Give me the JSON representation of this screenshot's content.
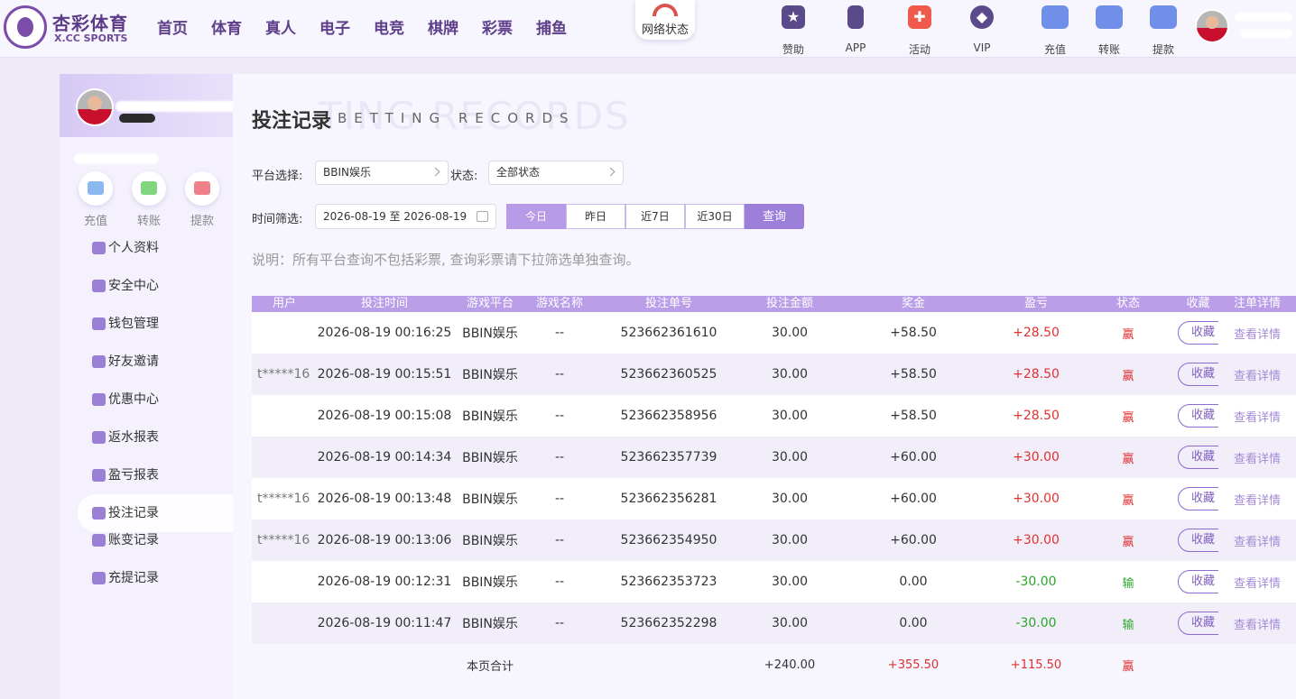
{
  "header": {
    "brand_title": "杏彩体育",
    "brand_sub": "X.CC SPORTS",
    "nav": [
      "首页",
      "体育",
      "真人",
      "电子",
      "电竞",
      "棋牌",
      "彩票",
      "捕鱼"
    ],
    "network_label": "网络状态",
    "tools": [
      {
        "label": "赞助",
        "icon": "bookmark-icon"
      },
      {
        "label": "APP",
        "icon": "phone-icon"
      },
      {
        "label": "活动",
        "icon": "gift-icon"
      },
      {
        "label": "VIP",
        "icon": "vip-diamond-icon"
      },
      {
        "label": "充值",
        "icon": "deposit-wallet-icon"
      },
      {
        "label": "转账",
        "icon": "transfer-wallet-icon"
      },
      {
        "label": "提款",
        "icon": "withdraw-wallet-icon"
      }
    ]
  },
  "sidebar": {
    "quick": [
      {
        "label": "充值",
        "icon": "deposit-icon"
      },
      {
        "label": "转账",
        "icon": "transfer-icon"
      },
      {
        "label": "提款",
        "icon": "withdraw-icon"
      }
    ],
    "menu": [
      {
        "label": "个人资料",
        "icon": "profile-icon"
      },
      {
        "label": "安全中心",
        "icon": "shield-icon"
      },
      {
        "label": "钱包管理",
        "icon": "wallet-icon"
      },
      {
        "label": "好友邀请",
        "icon": "invite-icon"
      },
      {
        "label": "优惠中心",
        "icon": "promo-icon"
      },
      {
        "label": "返水报表",
        "icon": "rebate-icon"
      },
      {
        "label": "盈亏报表",
        "icon": "profit-report-icon"
      },
      {
        "label": "投注记录",
        "icon": "bet-record-icon"
      },
      {
        "label": "账变记录",
        "icon": "account-change-icon"
      },
      {
        "label": "充提记录",
        "icon": "deposit-withdraw-record-icon"
      }
    ],
    "active_index": 7
  },
  "main": {
    "title": "投注记录",
    "title_en": "BETTING RECORDS",
    "ghost_text": "TING RECORDS",
    "platform_label": "平台选择:",
    "platform_value": "BBIN娱乐",
    "status_label": "状态:",
    "status_value": "全部状态",
    "time_label": "时间筛选:",
    "date_range": "2026-08-19 至 2026-08-19",
    "quick_ranges": [
      "今日",
      "昨日",
      "近7日",
      "近30日"
    ],
    "quick_selected": "今日",
    "search_label": "查询",
    "note": "说明：所有平台查询不包括彩票, 查询彩票请下拉筛选单独查询。"
  },
  "table": {
    "columns": [
      "用户",
      "投注时间",
      "游戏平台",
      "游戏名称",
      "投注单号",
      "投注金额",
      "奖金",
      "盈亏",
      "状态",
      "收藏",
      "注单详情"
    ],
    "fav_label": "收藏",
    "detail_label": "查看详情",
    "rows": [
      {
        "user": "",
        "time": "2026-08-19 00:16:25",
        "platform": "BBIN娱乐",
        "game": "--",
        "order": "523662361610",
        "amount": "30.00",
        "bonus": "+58.50",
        "profit": "+28.50",
        "status": "赢"
      },
      {
        "user": "t*****16",
        "time": "2026-08-19 00:15:51",
        "platform": "BBIN娱乐",
        "game": "--",
        "order": "523662360525",
        "amount": "30.00",
        "bonus": "+58.50",
        "profit": "+28.50",
        "status": "赢"
      },
      {
        "user": "",
        "time": "2026-08-19 00:15:08",
        "platform": "BBIN娱乐",
        "game": "--",
        "order": "523662358956",
        "amount": "30.00",
        "bonus": "+58.50",
        "profit": "+28.50",
        "status": "赢"
      },
      {
        "user": "",
        "time": "2026-08-19 00:14:34",
        "platform": "BBIN娱乐",
        "game": "--",
        "order": "523662357739",
        "amount": "30.00",
        "bonus": "+60.00",
        "profit": "+30.00",
        "status": "赢"
      },
      {
        "user": "t*****16",
        "time": "2026-08-19 00:13:48",
        "platform": "BBIN娱乐",
        "game": "--",
        "order": "523662356281",
        "amount": "30.00",
        "bonus": "+60.00",
        "profit": "+30.00",
        "status": "赢"
      },
      {
        "user": "t*****16",
        "time": "2026-08-19 00:13:06",
        "platform": "BBIN娱乐",
        "game": "--",
        "order": "523662354950",
        "amount": "30.00",
        "bonus": "+60.00",
        "profit": "+30.00",
        "status": "赢"
      },
      {
        "user": "",
        "time": "2026-08-19 00:12:31",
        "platform": "BBIN娱乐",
        "game": "--",
        "order": "523662353723",
        "amount": "30.00",
        "bonus": "0.00",
        "profit": "-30.00",
        "status": "输"
      },
      {
        "user": "",
        "time": "2026-08-19 00:11:47",
        "platform": "BBIN娱乐",
        "game": "--",
        "order": "523662352298",
        "amount": "30.00",
        "bonus": "0.00",
        "profit": "-30.00",
        "status": "输"
      }
    ],
    "total": {
      "label": "本页合计",
      "amount": "+240.00",
      "bonus": "+355.50",
      "profit": "+115.50",
      "status": "赢"
    }
  },
  "colors": {
    "accent": "#9b7fd9",
    "win": "#e03030",
    "lose": "#2aa52a"
  }
}
